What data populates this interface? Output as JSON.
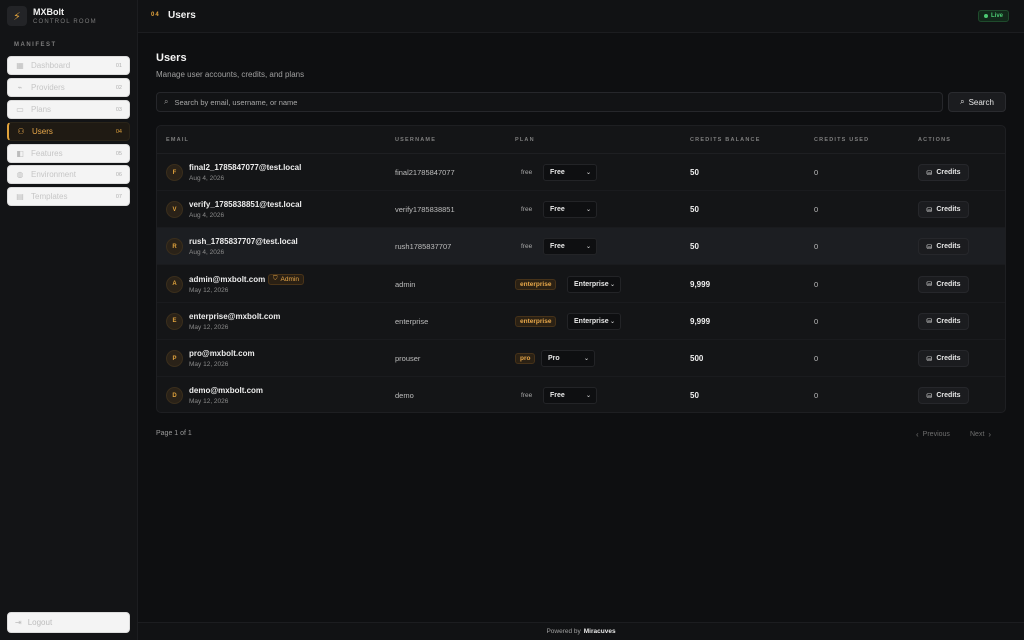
{
  "brand": {
    "name": "MXBolt",
    "subtitle": "CONTROL ROOM"
  },
  "sidebar": {
    "section_label": "MANIFEST",
    "items": [
      {
        "label": "Dashboard",
        "num": "01",
        "icon": "grid-icon"
      },
      {
        "label": "Providers",
        "num": "02",
        "icon": "plug-icon"
      },
      {
        "label": "Plans",
        "num": "03",
        "icon": "card-icon"
      },
      {
        "label": "Users",
        "num": "04",
        "icon": "users-icon",
        "active": true
      },
      {
        "label": "Features",
        "num": "05",
        "icon": "toggle-icon"
      },
      {
        "label": "Environment",
        "num": "06",
        "icon": "globe-icon"
      },
      {
        "label": "Templates",
        "num": "07",
        "icon": "file-icon"
      }
    ],
    "logout_label": "Logout"
  },
  "topbar": {
    "crumb_num": "04",
    "title": "Users",
    "live_label": "Live"
  },
  "main": {
    "title": "Users",
    "subtitle": "Manage user accounts, credits, and plans",
    "search_placeholder": "Search by email, username, or name",
    "search_button": "Search",
    "columns": [
      "EMAIL",
      "USERNAME",
      "PLAN",
      "CREDITS BALANCE",
      "CREDITS USED",
      "ACTIONS"
    ],
    "credits_button": "Credits",
    "rows": [
      {
        "initial": "F",
        "email": "final2_1785847077@test.local",
        "date": "Aug 4, 2026",
        "username": "final21785847077",
        "plan_tag": "free",
        "plan_select": "Free",
        "balance": "50",
        "used": "0"
      },
      {
        "initial": "V",
        "email": "verify_1785838851@test.local",
        "date": "Aug 4, 2026",
        "username": "verify1785838851",
        "plan_tag": "free",
        "plan_select": "Free",
        "balance": "50",
        "used": "0"
      },
      {
        "initial": "R",
        "email": "rush_1785837707@test.local",
        "date": "Aug 4, 2026",
        "username": "rush1785837707",
        "plan_tag": "free",
        "plan_select": "Free",
        "balance": "50",
        "used": "0"
      },
      {
        "initial": "A",
        "email": "admin@mxbolt.com",
        "date": "May 12, 2026",
        "username": "admin",
        "plan_tag": "enterprise",
        "plan_select": "Enterprise",
        "balance": "9,999",
        "used": "0",
        "badge": "Admin"
      },
      {
        "initial": "E",
        "email": "enterprise@mxbolt.com",
        "date": "May 12, 2026",
        "username": "enterprise",
        "plan_tag": "enterprise",
        "plan_select": "Enterprise",
        "balance": "9,999",
        "used": "0"
      },
      {
        "initial": "P",
        "email": "pro@mxbolt.com",
        "date": "May 12, 2026",
        "username": "prouser",
        "plan_tag": "pro",
        "plan_select": "Pro",
        "balance": "500",
        "used": "0"
      },
      {
        "initial": "D",
        "email": "demo@mxbolt.com",
        "date": "May 12, 2026",
        "username": "demo",
        "plan_tag": "free",
        "plan_select": "Free",
        "balance": "50",
        "used": "0"
      }
    ],
    "pager_info": "Page 1 of 1",
    "prev_label": "Previous",
    "next_label": "Next"
  },
  "footer": {
    "prefix": "Powered by",
    "name": "Miracuves"
  },
  "colors": {
    "accent": "#e0a23c",
    "live": "#4ccb73",
    "background": "#0e0f11"
  }
}
